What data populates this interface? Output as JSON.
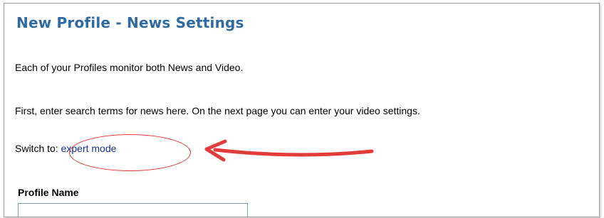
{
  "page": {
    "title": "New Profile - News Settings",
    "intro": "Each of your Profiles monitor both News and Video.",
    "instructions": "First, enter search terms for news here. On the next page you can enter your video settings.",
    "switch_prefix": "Switch to: ",
    "switch_link": "expert mode"
  },
  "form": {
    "profile_name_label": "Profile Name",
    "profile_name_value": ""
  },
  "annotation": {
    "color": "#e23b3b"
  },
  "colors": {
    "title": "#2f6aa3",
    "link": "#1a2f8a",
    "border": "#9a9a9a"
  }
}
